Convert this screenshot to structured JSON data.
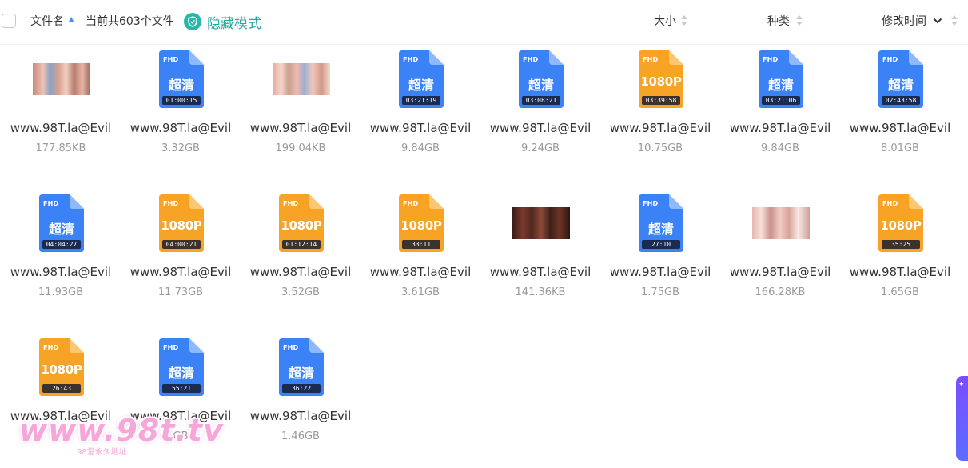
{
  "header": {
    "col_name": "文件名",
    "file_count": "当前共603个文件",
    "hide_mode": "隐藏模式",
    "col_size": "大小",
    "col_type": "种类",
    "col_modified": "修改时间"
  },
  "colors": {
    "blue_doc": "#3b82f6",
    "orange_doc": "#f7a325",
    "accent_teal": "#23b8a8"
  },
  "files": [
    {
      "name": "www.98T.la@Evil",
      "size": "177.85KB",
      "kind": "image",
      "photo": "a"
    },
    {
      "name": "www.98T.la@Evil",
      "size": "3.32GB",
      "kind": "video",
      "color": "blue",
      "badge": "超清",
      "duration": "01:00:15"
    },
    {
      "name": "www.98T.la@Evil",
      "size": "199.04KB",
      "kind": "image",
      "photo": "b"
    },
    {
      "name": "www.98T.la@Evil",
      "size": "9.84GB",
      "kind": "video",
      "color": "blue",
      "badge": "超清",
      "duration": "03:21:19"
    },
    {
      "name": "www.98T.la@Evil",
      "size": "9.24GB",
      "kind": "video",
      "color": "blue",
      "badge": "超清",
      "duration": "03:08:21"
    },
    {
      "name": "www.98T.la@Evil",
      "size": "10.75GB",
      "kind": "video",
      "color": "orange",
      "badge": "1080P",
      "duration": "03:39:58"
    },
    {
      "name": "www.98T.la@Evil",
      "size": "9.84GB",
      "kind": "video",
      "color": "blue",
      "badge": "超清",
      "duration": "03:21:06"
    },
    {
      "name": "www.98T.la@Evil",
      "size": "8.01GB",
      "kind": "video",
      "color": "blue",
      "badge": "超清",
      "duration": "02:43:58"
    },
    {
      "name": "www.98T.la@Evil",
      "size": "11.93GB",
      "kind": "video",
      "color": "blue",
      "badge": "超清",
      "duration": "04:04:27"
    },
    {
      "name": "www.98T.la@Evil",
      "size": "11.73GB",
      "kind": "video",
      "color": "orange",
      "badge": "1080P",
      "duration": "04:00:21"
    },
    {
      "name": "www.98T.la@Evil",
      "size": "3.52GB",
      "kind": "video",
      "color": "orange",
      "badge": "1080P",
      "duration": "01:12:14"
    },
    {
      "name": "www.98T.la@Evil",
      "size": "3.61GB",
      "kind": "video",
      "color": "orange",
      "badge": "1080P",
      "duration": "33:11"
    },
    {
      "name": "www.98T.la@Evil",
      "size": "141.36KB",
      "kind": "image",
      "photo": "c"
    },
    {
      "name": "www.98T.la@Evil",
      "size": "1.75GB",
      "kind": "video",
      "color": "blue",
      "badge": "超清",
      "duration": "27:10"
    },
    {
      "name": "www.98T.la@Evil",
      "size": "166.28KB",
      "kind": "image",
      "photo": "d"
    },
    {
      "name": "www.98T.la@Evil",
      "size": "1.65GB",
      "kind": "video",
      "color": "orange",
      "badge": "1080P",
      "duration": "35:25"
    },
    {
      "name": "www.98T.la@Evil",
      "size": "",
      "kind": "video",
      "color": "orange",
      "badge": "1080P",
      "duration": "26:43"
    },
    {
      "name": "www.98T.la@Evil",
      "size": "GB",
      "kind": "video",
      "color": "blue",
      "badge": "超清",
      "duration": "55:21"
    },
    {
      "name": "www.98T.la@Evil",
      "size": "1.46GB",
      "kind": "video",
      "color": "blue",
      "badge": "超清",
      "duration": "36:22"
    }
  ],
  "file_type_label": "FHD",
  "watermark": {
    "text": "www.98t.tv",
    "sub": "98堂永久地址"
  }
}
